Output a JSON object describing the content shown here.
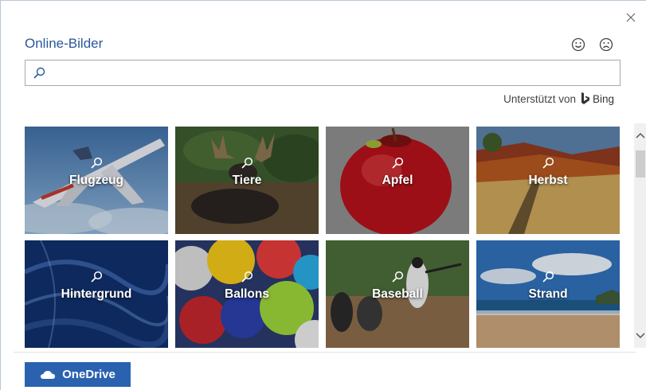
{
  "dialog": {
    "title": "Online-Bilder",
    "search": {
      "value": "",
      "placeholder": ""
    },
    "powered_by": {
      "prefix": "Unterstützt von",
      "brand": "Bing"
    },
    "feedback": {
      "happy_icon": "smiley-face-icon",
      "sad_icon": "frown-face-icon"
    },
    "tiles": [
      {
        "label": "Flugzeug"
      },
      {
        "label": "Tiere"
      },
      {
        "label": "Apfel"
      },
      {
        "label": "Herbst"
      },
      {
        "label": "Hintergrund"
      },
      {
        "label": "Ballons"
      },
      {
        "label": "Baseball"
      },
      {
        "label": "Strand"
      }
    ],
    "onedrive_button": {
      "label": "OneDrive",
      "icon": "cloud-icon"
    }
  },
  "colors": {
    "accent": "#2b579a",
    "button": "#2b62b0"
  }
}
